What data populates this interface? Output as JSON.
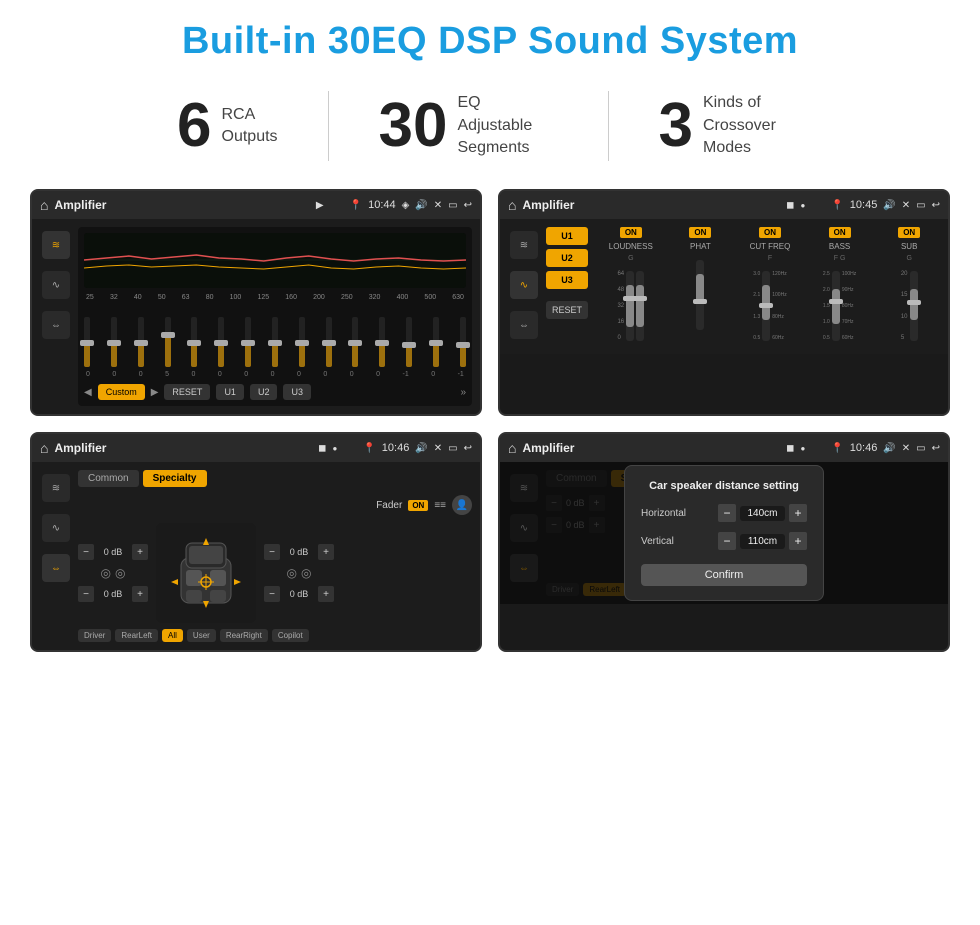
{
  "page": {
    "title": "Built-in 30EQ DSP Sound System",
    "stats": [
      {
        "number": "6",
        "text": "RCA\nOutputs"
      },
      {
        "number": "30",
        "text": "EQ Adjustable\nSegments"
      },
      {
        "number": "3",
        "text": "Kinds of\nCrossover Modes"
      }
    ]
  },
  "screen1": {
    "topbar": {
      "title": "Amplifier",
      "time": "10:44"
    },
    "freq_labels": [
      "25",
      "32",
      "40",
      "50",
      "63",
      "80",
      "100",
      "125",
      "160",
      "200",
      "250",
      "320",
      "400",
      "500",
      "630"
    ],
    "slider_values": [
      0,
      0,
      0,
      5,
      0,
      0,
      0,
      0,
      0,
      0,
      0,
      0,
      -1,
      0,
      -1
    ],
    "bottom_btns": [
      "Custom",
      "RESET",
      "U1",
      "U2",
      "U3"
    ]
  },
  "screen2": {
    "topbar": {
      "title": "Amplifier",
      "time": "10:45"
    },
    "presets": [
      "U1",
      "U2",
      "U3"
    ],
    "controls": [
      {
        "label": "LOUDNESS",
        "sublabel": "",
        "on": true
      },
      {
        "label": "PHAT",
        "sublabel": "",
        "on": true
      },
      {
        "label": "CUT FREQ",
        "sublabel": "F",
        "on": true
      },
      {
        "label": "BASS",
        "sublabel": "F G",
        "on": true
      },
      {
        "label": "SUB",
        "sublabel": "G",
        "on": true
      }
    ]
  },
  "screen3": {
    "topbar": {
      "title": "Amplifier",
      "time": "10:46"
    },
    "tabs": [
      "Common",
      "Specialty"
    ],
    "active_tab": "Specialty",
    "fader_label": "Fader",
    "fader_on": "ON",
    "db_values": [
      "0 dB",
      "0 dB",
      "0 dB",
      "0 dB"
    ],
    "seat_btns": [
      "Driver",
      "RearLeft",
      "All",
      "User",
      "RearRight",
      "Copilot"
    ]
  },
  "screen4": {
    "topbar": {
      "title": "Amplifier",
      "time": "10:46"
    },
    "tabs": [
      "Common",
      "Specialty"
    ],
    "dialog": {
      "title": "Car speaker distance setting",
      "horizontal_label": "Horizontal",
      "horizontal_value": "140cm",
      "vertical_label": "Vertical",
      "vertical_value": "110cm",
      "confirm_btn": "Confirm"
    }
  },
  "icons": {
    "home": "⌂",
    "back": "↩",
    "play": "▶",
    "prev": "◀",
    "next": "▶",
    "wifi": "◉",
    "volume": "🔊",
    "close": "✕",
    "minimize": "—",
    "settings": "⚙",
    "eq": "≋",
    "wave": "∿",
    "arrows": "⇔",
    "pin": "📍",
    "camera": "◈",
    "person": "👤"
  }
}
